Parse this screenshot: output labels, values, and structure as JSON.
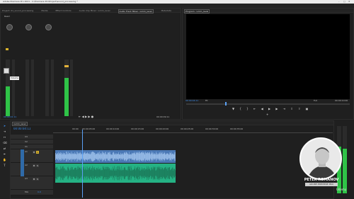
{
  "title_bar": {
    "title": "Adobe Premiere Pro 2021 - C:\\Premiere Pro\\Project\\sound_processing *"
  },
  "menu": [
    "File",
    "Edit",
    "Clip",
    "Sequence",
    "Markers",
    "Graphics",
    "View",
    "Window",
    "Help"
  ],
  "source_panel": {
    "tabs": [
      "Project: 01_sound_processing",
      "Media",
      "Effect Controls",
      "Audio Clip Mixer: rumm_level",
      "Audio Track Mixer: rumm_level",
      "Metadata"
    ],
    "channels": [
      "Audio 1",
      "Audio 2",
      "Audio 3",
      "Mix"
    ],
    "read_mode": "Read",
    "tooltip": "Volume",
    "timecode": "00:00:01:11",
    "end_timecode": "00:00:09:11"
  },
  "program_panel": {
    "tab": "Program: rumm_level",
    "timecode": "00:00:04:11",
    "fit": "Fit",
    "quality": "Full",
    "duration": "00:00:10:00"
  },
  "timeline": {
    "tab": "rumm_level",
    "timecode": "00:00:04:11",
    "ruler": [
      "00:00",
      "00:00:05:00",
      "00:00:10:00",
      "00:00:15:00",
      "00:00:20:00",
      "00:00:25:00",
      "00:00:30:00",
      "00:00:35:00"
    ],
    "tracks": [
      "V3",
      "V2",
      "V1",
      "A1",
      "A2",
      "A3",
      "Mix"
    ],
    "mix_value": "0.0"
  },
  "presenter": {
    "name": "PETER ROMANOV",
    "role": "ADOBE PREMIERE PRO",
    "brand": "Udemy"
  },
  "colors": {
    "audio_blue": "#4a78b5",
    "audio_green": "#25b284",
    "meter_green": "#2fc347",
    "accent_blue": "#3c8ff0",
    "playhead": "#5aa0f5"
  }
}
